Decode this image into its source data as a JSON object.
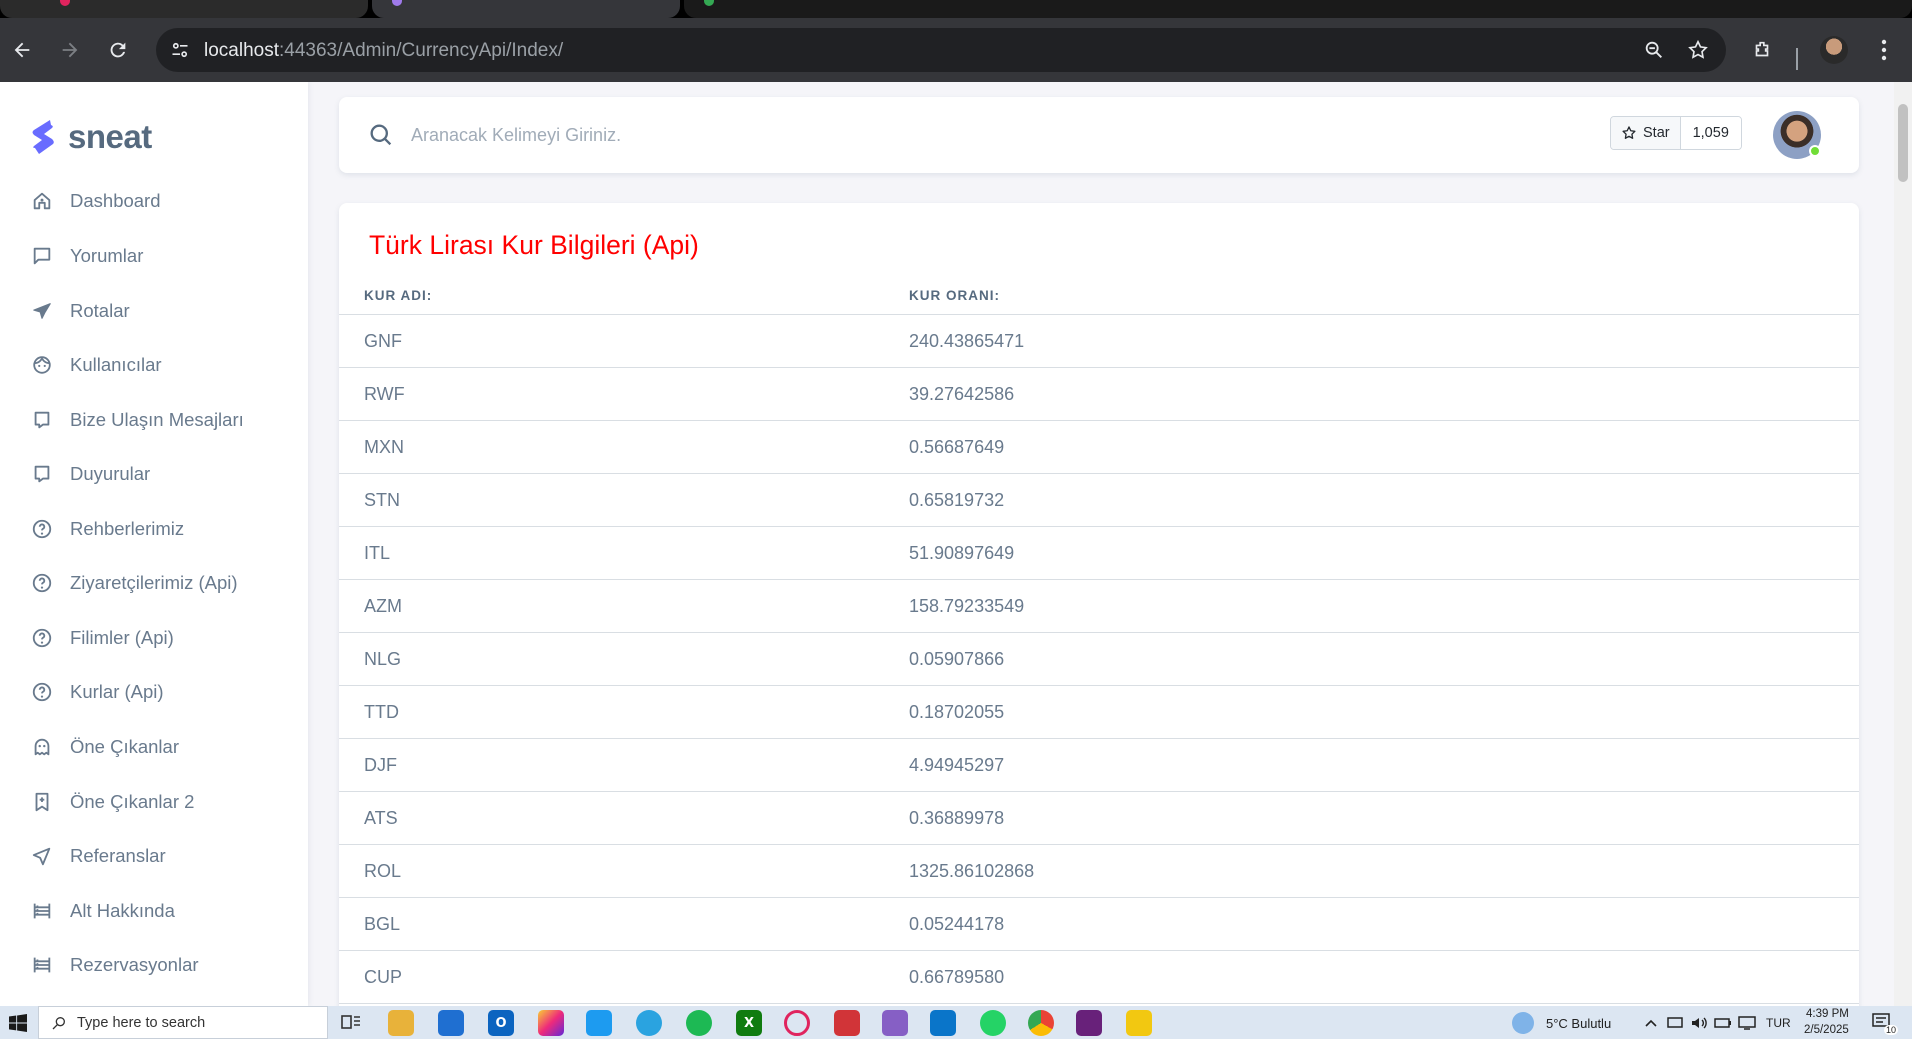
{
  "browser": {
    "url_host": "localhost",
    "url_rest": ":44363/Admin/CurrencyApi/Index/"
  },
  "sidebar": {
    "brand": "sneat",
    "items": [
      {
        "label": "Dashboard",
        "icon": "home-icon"
      },
      {
        "label": "Yorumlar",
        "icon": "comment-icon"
      },
      {
        "label": "Rotalar",
        "icon": "plane-icon"
      },
      {
        "label": "Kullanıcılar",
        "icon": "user-face-icon"
      },
      {
        "label": "Bize Ulaşın Mesajları",
        "icon": "message-icon"
      },
      {
        "label": "Duyurular",
        "icon": "message-icon"
      },
      {
        "label": "Rehberlerimiz",
        "icon": "help-circle-icon"
      },
      {
        "label": "Ziyaretçilerimiz (Api)",
        "icon": "help-circle-icon"
      },
      {
        "label": "Filimler (Api)",
        "icon": "help-circle-icon"
      },
      {
        "label": "Kurlar (Api)",
        "icon": "help-circle-icon"
      },
      {
        "label": "Öne Çıkanlar",
        "icon": "ghost-icon"
      },
      {
        "label": "Öne Çıkanlar 2",
        "icon": "bookmark-icon"
      },
      {
        "label": "Referanslar",
        "icon": "send-icon"
      },
      {
        "label": "Alt Hakkında",
        "icon": "list-icon"
      },
      {
        "label": "Rezervasyonlar",
        "icon": "list-icon"
      }
    ]
  },
  "search": {
    "placeholder": "Aranacak Kelimeyi Giriniz."
  },
  "github": {
    "star_label": "Star",
    "count": "1,059"
  },
  "card": {
    "title": "Türk Lirası Kur Bilgileri (Api)",
    "col_name": "KUR ADI:",
    "col_rate": "KUR ORANI:",
    "rows": [
      {
        "name": "GNF",
        "rate": "240.43865471"
      },
      {
        "name": "RWF",
        "rate": "39.27642586"
      },
      {
        "name": "MXN",
        "rate": "0.56687649"
      },
      {
        "name": "STN",
        "rate": "0.65819732"
      },
      {
        "name": "ITL",
        "rate": "51.90897649"
      },
      {
        "name": "AZM",
        "rate": "158.79233549"
      },
      {
        "name": "NLG",
        "rate": "0.05907866"
      },
      {
        "name": "TTD",
        "rate": "0.18702055"
      },
      {
        "name": "DJF",
        "rate": "4.94945297"
      },
      {
        "name": "ATS",
        "rate": "0.36889978"
      },
      {
        "name": "ROL",
        "rate": "1325.86102868"
      },
      {
        "name": "BGL",
        "rate": "0.05244178"
      },
      {
        "name": "CUP",
        "rate": "0.66789580"
      }
    ]
  },
  "taskbar": {
    "search_placeholder": "Type here to search",
    "weather": "5°C  Bulutlu",
    "lang": "TUR",
    "time": "4:39 PM",
    "date": "2/5/2025",
    "notif_count": "10"
  },
  "colors": {
    "title_red": "#ff0000",
    "brand_purple": "#696cff",
    "text": "#697a8d"
  }
}
